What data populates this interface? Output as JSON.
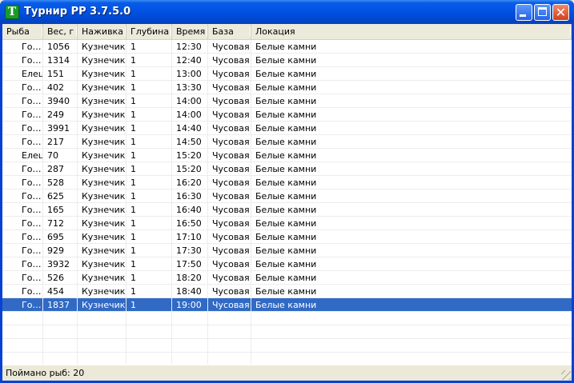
{
  "window": {
    "title": "Турнир РР 3.7.5.0",
    "icon_letter": "T",
    "icon": "app-green-t-icon",
    "buttons": [
      "minimize-icon",
      "maximize-icon",
      "close-icon"
    ]
  },
  "columns": [
    "Рыба",
    "Вес, г",
    "Наживка",
    "Глубина",
    "Время",
    "База",
    "Локация"
  ],
  "rows": [
    [
      "Го…",
      "1056",
      "Кузнечик",
      "1",
      "12:30",
      "Чусовая",
      "Белые камни"
    ],
    [
      "Го…",
      "1314",
      "Кузнечик",
      "1",
      "12:40",
      "Чусовая",
      "Белые камни"
    ],
    [
      "Елец",
      "151",
      "Кузнечик",
      "1",
      "13:00",
      "Чусовая",
      "Белые камни"
    ],
    [
      "Го…",
      "402",
      "Кузнечик",
      "1",
      "13:30",
      "Чусовая",
      "Белые камни"
    ],
    [
      "Го…",
      "3940",
      "Кузнечик",
      "1",
      "14:00",
      "Чусовая",
      "Белые камни"
    ],
    [
      "Го…",
      "249",
      "Кузнечик",
      "1",
      "14:00",
      "Чусовая",
      "Белые камни"
    ],
    [
      "Го…",
      "3991",
      "Кузнечик",
      "1",
      "14:40",
      "Чусовая",
      "Белые камни"
    ],
    [
      "Го…",
      "217",
      "Кузнечик",
      "1",
      "14:50",
      "Чусовая",
      "Белые камни"
    ],
    [
      "Елец",
      "70",
      "Кузнечик",
      "1",
      "15:20",
      "Чусовая",
      "Белые камни"
    ],
    [
      "Го…",
      "287",
      "Кузнечик",
      "1",
      "15:20",
      "Чусовая",
      "Белые камни"
    ],
    [
      "Го…",
      "528",
      "Кузнечик",
      "1",
      "16:20",
      "Чусовая",
      "Белые камни"
    ],
    [
      "Го…",
      "625",
      "Кузнечик",
      "1",
      "16:30",
      "Чусовая",
      "Белые камни"
    ],
    [
      "Го…",
      "165",
      "Кузнечик",
      "1",
      "16:40",
      "Чусовая",
      "Белые камни"
    ],
    [
      "Го…",
      "712",
      "Кузнечик",
      "1",
      "16:50",
      "Чусовая",
      "Белые камни"
    ],
    [
      "Го…",
      "695",
      "Кузнечик",
      "1",
      "17:10",
      "Чусовая",
      "Белые камни"
    ],
    [
      "Го…",
      "929",
      "Кузнечик",
      "1",
      "17:30",
      "Чусовая",
      "Белые камни"
    ],
    [
      "Го…",
      "3932",
      "Кузнечик",
      "1",
      "17:50",
      "Чусовая",
      "Белые камни"
    ],
    [
      "Го…",
      "526",
      "Кузнечик",
      "1",
      "18:20",
      "Чусовая",
      "Белые камни"
    ],
    [
      "Го…",
      "454",
      "Кузнечик",
      "1",
      "18:40",
      "Чусовая",
      "Белые камни"
    ],
    [
      "Го…",
      "1837",
      "Кузнечик",
      "1",
      "19:00",
      "Чусовая",
      "Белые камни"
    ]
  ],
  "selected_row_index": 19,
  "colors": {
    "selection": "#316ac5",
    "titlebar": "#0055e5",
    "window_face": "#ece9d8"
  },
  "status": {
    "text": "Поймано рыб: 20"
  }
}
